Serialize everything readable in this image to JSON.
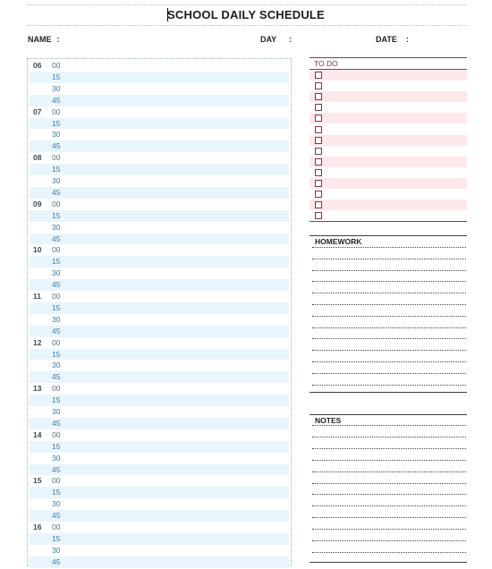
{
  "header": {
    "title": "SCHOOL DAILY SCHEDULE",
    "fields": [
      {
        "label": "NAME",
        "separator": ":"
      },
      {
        "label": "DAY",
        "separator": ":"
      },
      {
        "label": "DATE",
        "separator": ":"
      }
    ]
  },
  "schedule": {
    "hours": [
      "06",
      "07",
      "08",
      "09",
      "10",
      "11",
      "12",
      "13",
      "14",
      "15",
      "16"
    ],
    "minutes": [
      "00",
      "15",
      "30",
      "45"
    ],
    "accent_color": "#e9f5fc"
  },
  "todo": {
    "title": "TO DO",
    "item_count": 14,
    "accent_color": "#fde8ec"
  },
  "homework": {
    "title": "HOMEWORK",
    "line_count": 13
  },
  "notes": {
    "title": "NOTES",
    "line_count": 12
  }
}
